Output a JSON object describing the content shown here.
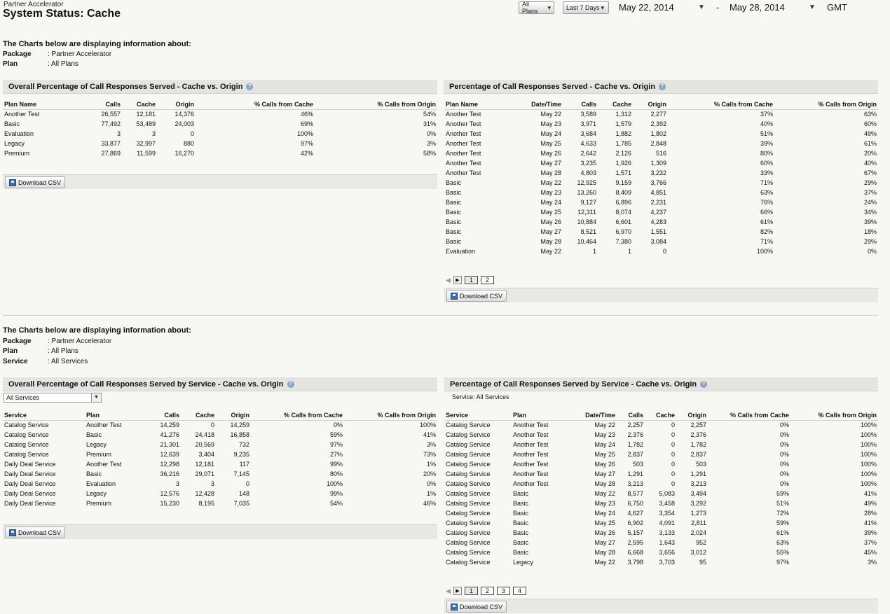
{
  "header": {
    "crumb": "Partner Accelerator",
    "title": "System Status: Cache",
    "plans_btn": "All Plans",
    "days_btn": "Last 7 Days",
    "start_date": "May 22, 2014",
    "end_date": "May 28, 2014",
    "dash": "-",
    "tz": "GMT"
  },
  "info1": {
    "heading": "The Charts below are displaying information about:",
    "rows": [
      [
        "Package",
        ": Partner Accelerator"
      ],
      [
        "Plan",
        ": All Plans"
      ]
    ]
  },
  "info2": {
    "heading": "The Charts below are displaying information about:",
    "rows": [
      [
        "Package",
        ": Partner Accelerator"
      ],
      [
        "Plan",
        ": All Plans"
      ],
      [
        "Service",
        ": All Services"
      ]
    ]
  },
  "download_label": "Download CSV",
  "panels": {
    "p1": {
      "title": "Overall Percentage of Call Responses Served - Cache vs. Origin",
      "cols": [
        "Plan Name",
        "Calls",
        "Cache",
        "Origin",
        "% Calls from Cache",
        "% Calls from Origin"
      ],
      "rows": [
        [
          "Another Test",
          "26,557",
          "12,181",
          "14,376",
          "46%",
          "54%"
        ],
        [
          "Basic",
          "77,492",
          "53,489",
          "24,003",
          "69%",
          "31%"
        ],
        [
          "Evaluation",
          "3",
          "3",
          "0",
          "100%",
          "0%"
        ],
        [
          "Legacy",
          "33,877",
          "32,997",
          "880",
          "97%",
          "3%"
        ],
        [
          "Premium",
          "27,869",
          "11,599",
          "16,270",
          "42%",
          "58%"
        ]
      ]
    },
    "p2": {
      "title": "Percentage of Call Responses Served - Cache vs. Origin",
      "cols": [
        "Plan Name",
        "Date/Time",
        "Calls",
        "Cache",
        "Origin",
        "% Calls from Cache",
        "% Calls from Origin"
      ],
      "rows": [
        [
          "Another Test",
          "May 22",
          "3,589",
          "1,312",
          "2,277",
          "37%",
          "63%"
        ],
        [
          "Another Test",
          "May 23",
          "3,971",
          "1,579",
          "2,392",
          "40%",
          "60%"
        ],
        [
          "Another Test",
          "May 24",
          "3,684",
          "1,882",
          "1,802",
          "51%",
          "49%"
        ],
        [
          "Another Test",
          "May 25",
          "4,633",
          "1,785",
          "2,848",
          "39%",
          "61%"
        ],
        [
          "Another Test",
          "May 26",
          "2,642",
          "2,126",
          "516",
          "80%",
          "20%"
        ],
        [
          "Another Test",
          "May 27",
          "3,235",
          "1,926",
          "1,309",
          "60%",
          "40%"
        ],
        [
          "Another Test",
          "May 28",
          "4,803",
          "1,571",
          "3,232",
          "33%",
          "67%"
        ],
        [
          "Basic",
          "May 22",
          "12,925",
          "9,159",
          "3,766",
          "71%",
          "29%"
        ],
        [
          "Basic",
          "May 23",
          "13,260",
          "8,409",
          "4,851",
          "63%",
          "37%"
        ],
        [
          "Basic",
          "May 24",
          "9,127",
          "6,896",
          "2,231",
          "76%",
          "24%"
        ],
        [
          "Basic",
          "May 25",
          "12,311",
          "8,074",
          "4,237",
          "66%",
          "34%"
        ],
        [
          "Basic",
          "May 26",
          "10,884",
          "6,601",
          "4,283",
          "61%",
          "39%"
        ],
        [
          "Basic",
          "May 27",
          "8,521",
          "6,970",
          "1,551",
          "82%",
          "18%"
        ],
        [
          "Basic",
          "May 28",
          "10,464",
          "7,380",
          "3,084",
          "71%",
          "29%"
        ],
        [
          "Evaluation",
          "May 22",
          "1",
          "1",
          "0",
          "100%",
          "0%"
        ]
      ],
      "pages": [
        "1",
        "2"
      ]
    },
    "p3": {
      "title": "Overall Percentage of Call Responses Served by Service - Cache vs. Origin",
      "select": "All Services",
      "cols": [
        "Service",
        "Plan",
        "Calls",
        "Cache",
        "Origin",
        "% Calls from Cache",
        "% Calls from Origin"
      ],
      "rows": [
        [
          "Catalog Service",
          "Another Test",
          "14,259",
          "0",
          "14,259",
          "0%",
          "100%"
        ],
        [
          "Catalog Service",
          "Basic",
          "41,276",
          "24,418",
          "16,858",
          "59%",
          "41%"
        ],
        [
          "Catalog Service",
          "Legacy",
          "21,301",
          "20,569",
          "732",
          "97%",
          "3%"
        ],
        [
          "Catalog Service",
          "Premium",
          "12,639",
          "3,404",
          "9,235",
          "27%",
          "73%"
        ],
        [
          "Daily Deal Service",
          "Another Test",
          "12,298",
          "12,181",
          "117",
          "99%",
          "1%"
        ],
        [
          "Daily Deal Service",
          "Basic",
          "36,216",
          "29,071",
          "7,145",
          "80%",
          "20%"
        ],
        [
          "Daily Deal Service",
          "Evaluation",
          "3",
          "3",
          "0",
          "100%",
          "0%"
        ],
        [
          "Daily Deal Service",
          "Legacy",
          "12,576",
          "12,428",
          "148",
          "99%",
          "1%"
        ],
        [
          "Daily Deal Service",
          "Premium",
          "15,230",
          "8,195",
          "7,035",
          "54%",
          "46%"
        ]
      ]
    },
    "p4": {
      "title": "Percentage of Call Responses Served by Service - Cache vs. Origin",
      "subtitle": "Service: All Services",
      "cols": [
        "Service",
        "Plan",
        "Date/Time",
        "Calls",
        "Cache",
        "Origin",
        "% Calls from Cache",
        "% Calls from Origin"
      ],
      "rows": [
        [
          "Catalog Service",
          "Another Test",
          "May 22",
          "2,257",
          "0",
          "2,257",
          "0%",
          "100%"
        ],
        [
          "Catalog Service",
          "Another Test",
          "May 23",
          "2,376",
          "0",
          "2,376",
          "0%",
          "100%"
        ],
        [
          "Catalog Service",
          "Another Test",
          "May 24",
          "1,782",
          "0",
          "1,782",
          "0%",
          "100%"
        ],
        [
          "Catalog Service",
          "Another Test",
          "May 25",
          "2,837",
          "0",
          "2,837",
          "0%",
          "100%"
        ],
        [
          "Catalog Service",
          "Another Test",
          "May 26",
          "503",
          "0",
          "503",
          "0%",
          "100%"
        ],
        [
          "Catalog Service",
          "Another Test",
          "May 27",
          "1,291",
          "0",
          "1,291",
          "0%",
          "100%"
        ],
        [
          "Catalog Service",
          "Another Test",
          "May 28",
          "3,213",
          "0",
          "3,213",
          "0%",
          "100%"
        ],
        [
          "Catalog Service",
          "Basic",
          "May 22",
          "8,577",
          "5,083",
          "3,494",
          "59%",
          "41%"
        ],
        [
          "Catalog Service",
          "Basic",
          "May 23",
          "6,750",
          "3,458",
          "3,292",
          "51%",
          "49%"
        ],
        [
          "Catalog Service",
          "Basic",
          "May 24",
          "4,627",
          "3,354",
          "1,273",
          "72%",
          "28%"
        ],
        [
          "Catalog Service",
          "Basic",
          "May 25",
          "6,902",
          "4,091",
          "2,811",
          "59%",
          "41%"
        ],
        [
          "Catalog Service",
          "Basic",
          "May 26",
          "5,157",
          "3,133",
          "2,024",
          "61%",
          "39%"
        ],
        [
          "Catalog Service",
          "Basic",
          "May 27",
          "2,595",
          "1,643",
          "952",
          "63%",
          "37%"
        ],
        [
          "Catalog Service",
          "Basic",
          "May 28",
          "6,668",
          "3,656",
          "3,012",
          "55%",
          "45%"
        ],
        [
          "Catalog Service",
          "Legacy",
          "May 22",
          "3,798",
          "3,703",
          "95",
          "97%",
          "3%"
        ]
      ],
      "pages": [
        "1",
        "2",
        "3",
        "4"
      ]
    }
  }
}
